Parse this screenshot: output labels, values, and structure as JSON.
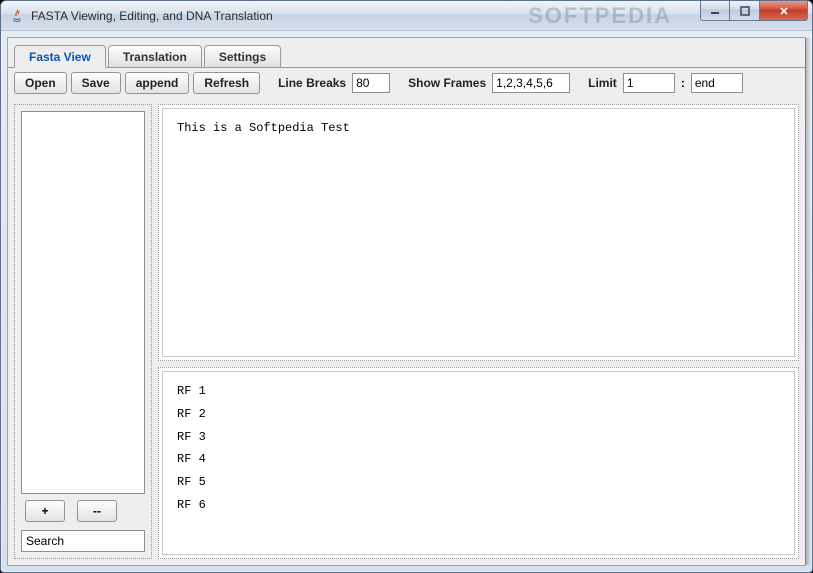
{
  "window": {
    "title": "FASTA Viewing, Editing, and DNA Translation",
    "watermark": "SOFTPEDIA"
  },
  "tabs": {
    "fasta_view": "Fasta View",
    "translation": "Translation",
    "settings": "Settings"
  },
  "toolbar": {
    "open": "Open",
    "save": "Save",
    "append": "append",
    "refresh": "Refresh",
    "line_breaks_label": "Line Breaks",
    "line_breaks_value": "80",
    "show_frames_label": "Show Frames",
    "show_frames_value": "1,2,3,4,5,6",
    "limit_label": "Limit",
    "limit_from": "1",
    "limit_sep": ":",
    "limit_to": "end"
  },
  "left": {
    "plus": "+",
    "minus": "--",
    "search_placeholder": "Search"
  },
  "editor": {
    "content": "This is a Softpedia Test"
  },
  "frames": {
    "lines": [
      "RF 1",
      "RF 2",
      "RF 3",
      "RF 4",
      "RF 5",
      "RF 6"
    ]
  }
}
